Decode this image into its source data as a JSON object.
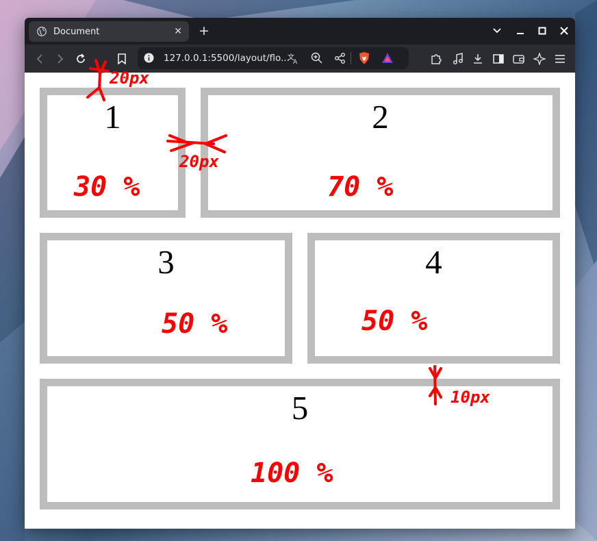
{
  "browser": {
    "tab_title": "Document",
    "tab_close": "✕",
    "new_tab": "+",
    "url": "127.0.0.1:5500/layout/flo..."
  },
  "boxes": [
    {
      "number": "1",
      "annotation": "30 %"
    },
    {
      "number": "2",
      "annotation": "70 %"
    },
    {
      "number": "3",
      "annotation": "50 %"
    },
    {
      "number": "4",
      "annotation": "50 %"
    },
    {
      "number": "5",
      "annotation": "100 %"
    }
  ],
  "annotations": {
    "top_gap": "20px",
    "side_gap": "20px",
    "row_gap": "10px",
    "color": "#ff0000"
  },
  "colors": {
    "box_border": "#bdbdbd",
    "titlebar": "#1c1d22",
    "toolbar": "#2b2c31"
  }
}
